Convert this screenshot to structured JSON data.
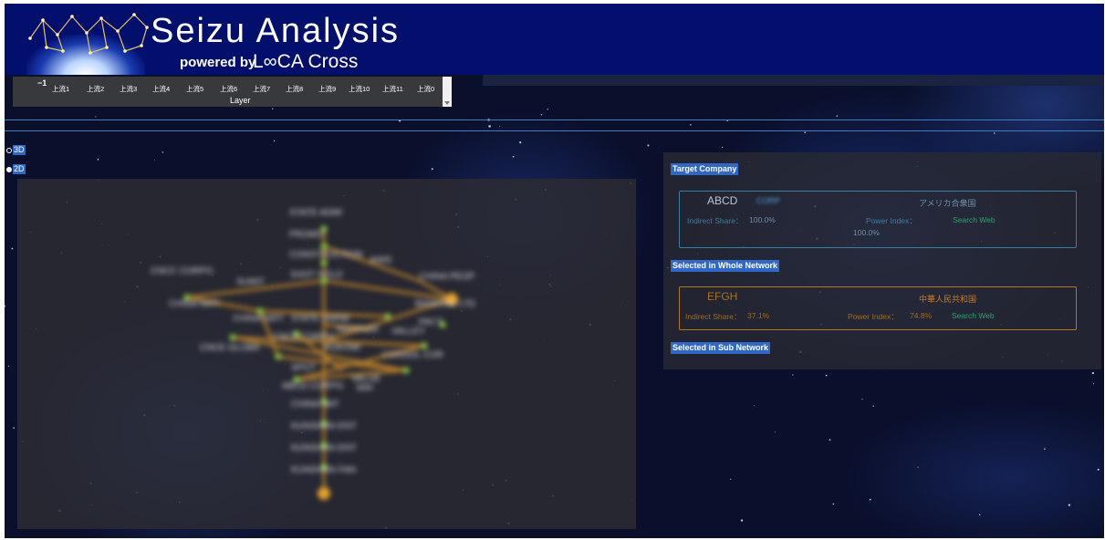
{
  "header": {
    "app_title": "Seizu Analysis",
    "powered_by": "powered by",
    "brand": "L∞CA Cross",
    "logo_icon": "constellation-logo-icon"
  },
  "layer_slider": {
    "min_tick": "−1",
    "ticks": [
      "上流1",
      "上流2",
      "上流3",
      "上流4",
      "上流5",
      "上流6",
      "上流7",
      "上流8",
      "上流9",
      "上流10",
      "上流11",
      "上流0"
    ],
    "label": "Layer"
  },
  "view_mode": {
    "options": [
      "3D",
      "2D"
    ],
    "selected": "2D"
  },
  "graph": {
    "node_labels": [
      "STATE ADMI",
      "PROMO",
      "CONSTRUCTION",
      "AIMS",
      "EAST HOLD",
      "CHINA PEOP",
      "CNCC CORPO",
      "SUMIT",
      "CHINA NATI",
      "BANKING LTD",
      "CHINA NATI",
      "STATE OWNE",
      "CNCE GLOBA",
      "INSTRUM",
      "VALLEY",
      "ROKISM",
      "PACT",
      "CNCE CORPO",
      "CONSOL COR",
      "SPOT",
      "VALUE",
      "ABCD CORPO",
      "MAI",
      "CHINA NAT",
      "KUNSHAN ENT",
      "KUNSHAN ENT",
      "KUNSHAN FAN"
    ]
  },
  "target_company": {
    "section_label": "Target Company",
    "name": "ABCD",
    "suffix": "CORP",
    "country": "アメリカ合衆国",
    "indirect_share_label": "Indirect Share：",
    "indirect_share_value": "100.0%",
    "power_index_label": "Power Index：",
    "power_index_value": "100.0%",
    "search_web": "Search Web",
    "accent_color": "#3a7d9e"
  },
  "whole_network": {
    "section_label": "Selected in Whole Network",
    "name": "EFGH",
    "country": "中華人民共和国",
    "indirect_share_label": "Indirect Share：",
    "indirect_share_value": "37.1%",
    "power_index_label": "Power Index：",
    "power_index_value": "74.8%",
    "search_web": "Search Web",
    "accent_color": "#b07a1c"
  },
  "sub_network": {
    "section_label": "Selected in Sub Network"
  },
  "colors": {
    "header_bg": "#030f6d",
    "highlight": "#2f68c8",
    "edge": "#c88a2a",
    "node_green": "#8fd13f",
    "node_orange": "#e5a12a"
  }
}
